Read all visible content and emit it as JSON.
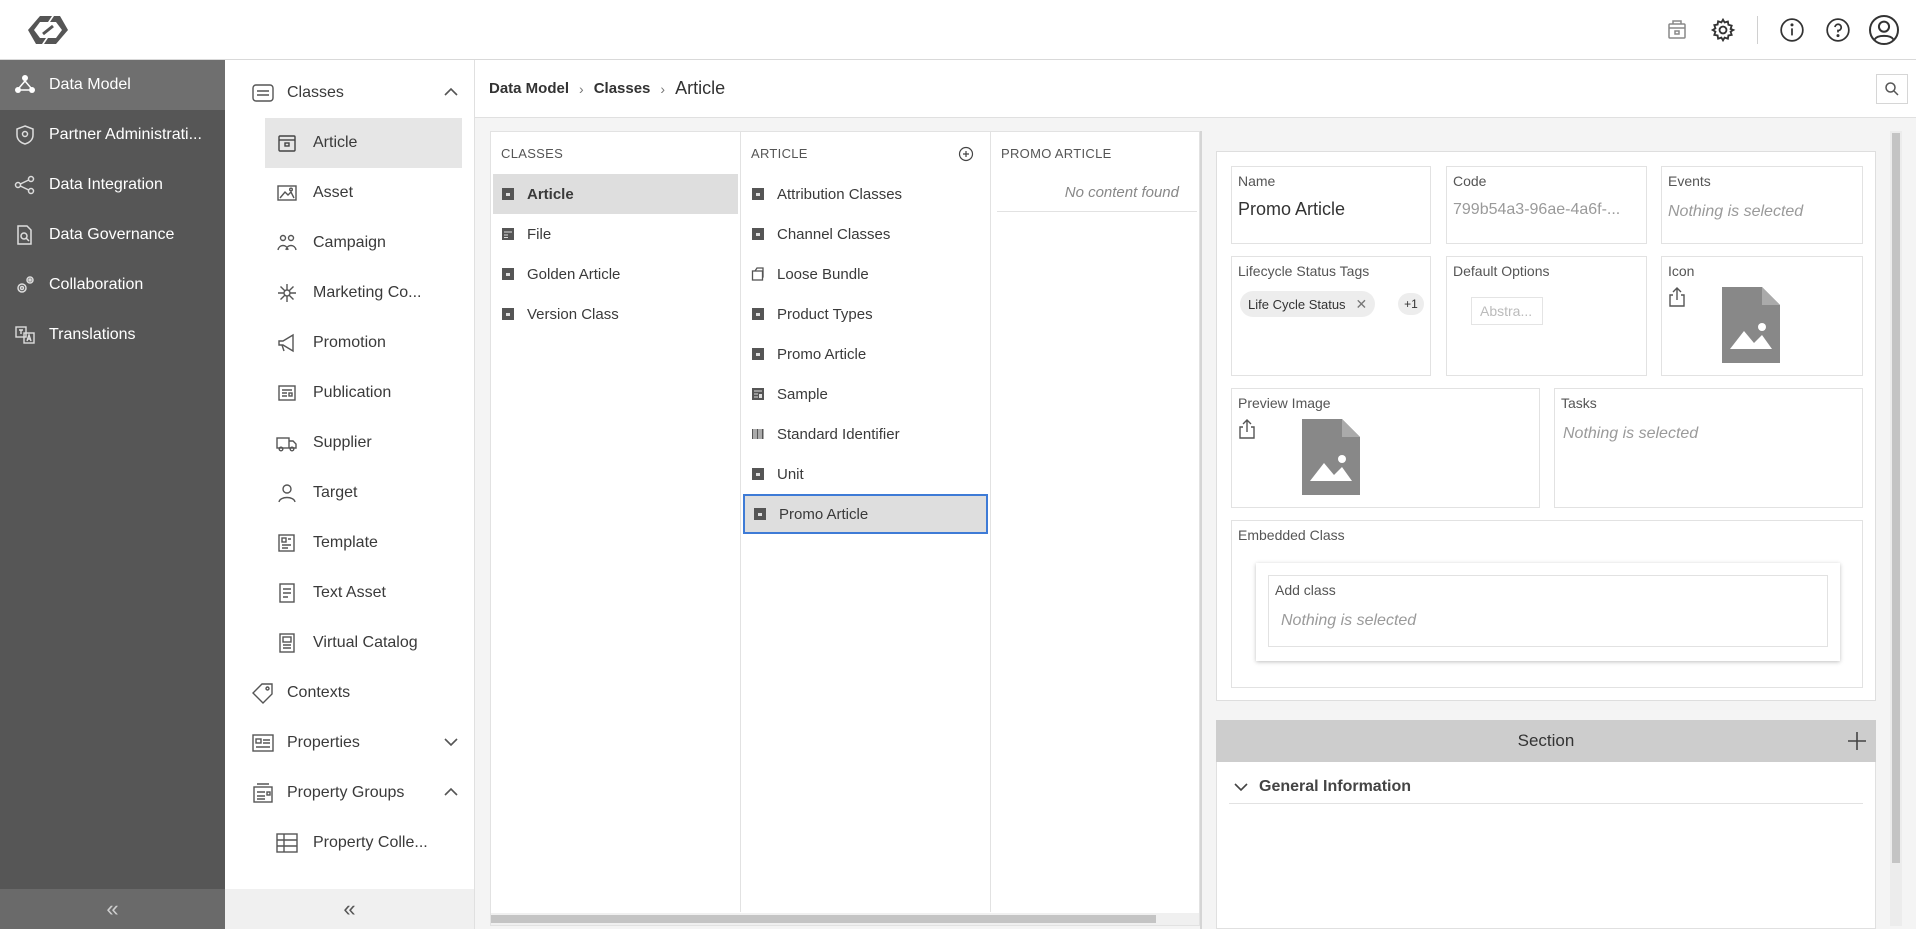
{
  "nav": {
    "items": [
      {
        "label": "Data Model",
        "icon": "data-model-icon"
      },
      {
        "label": "Partner Administrati...",
        "icon": "shield-icon"
      },
      {
        "label": "Data Integration",
        "icon": "share-nodes-icon"
      },
      {
        "label": "Data Governance",
        "icon": "document-search-icon"
      },
      {
        "label": "Collaboration",
        "icon": "gears-icon"
      },
      {
        "label": "Translations",
        "icon": "translate-icon"
      }
    ],
    "collapse": "«"
  },
  "subnav": {
    "classes_label": "Classes",
    "items": [
      {
        "label": "Article"
      },
      {
        "label": "Asset"
      },
      {
        "label": "Campaign"
      },
      {
        "label": "Marketing Co..."
      },
      {
        "label": "Promotion"
      },
      {
        "label": "Publication"
      },
      {
        "label": "Supplier"
      },
      {
        "label": "Target"
      },
      {
        "label": "Template"
      },
      {
        "label": "Text Asset"
      },
      {
        "label": "Virtual Catalog"
      }
    ],
    "contexts_label": "Contexts",
    "properties_label": "Properties",
    "property_groups_label": "Property Groups",
    "property_collections_label": "Property Colle...",
    "collapse": "«"
  },
  "breadcrumb": {
    "first": "Data Model",
    "second": "Classes",
    "current": "Article",
    "sep": "›"
  },
  "columns": {
    "classes": {
      "header": "CLASSES",
      "rows": [
        "Article",
        "File",
        "Golden Article",
        "Version Class"
      ]
    },
    "article": {
      "header": "ARTICLE",
      "rows": [
        "Attribution Classes",
        "Channel Classes",
        "Loose Bundle",
        "Product Types",
        "Promo Article",
        "Sample",
        "Standard Identifier",
        "Unit",
        "Promo Article"
      ]
    },
    "promo": {
      "header": "PROMO ARTICLE",
      "empty": "No content found"
    }
  },
  "detail": {
    "name_label": "Name",
    "name_value": "Promo Article",
    "code_label": "Code",
    "code_value": "799b54a3-96ae-4a6f-...",
    "events_label": "Events",
    "events_value": "Nothing is selected",
    "lifecycle_label": "Lifecycle Status Tags",
    "lifecycle_chip": "Life Cycle Status",
    "lifecycle_more": "+1",
    "default_options_label": "Default Options",
    "default_options_value": "Abstra...",
    "icon_label": "Icon",
    "preview_label": "Preview Image",
    "tasks_label": "Tasks",
    "tasks_value": "Nothing is selected",
    "embedded_label": "Embedded Class",
    "add_class_label": "Add class",
    "add_class_value": "Nothing is selected",
    "section_label": "Section",
    "general_label": "General Information"
  },
  "colors": {
    "nav_bg": "#565656",
    "nav_active": "#6f6f6f",
    "selection_outline": "#3e7bd6",
    "section_bg": "#cdcdcd"
  }
}
